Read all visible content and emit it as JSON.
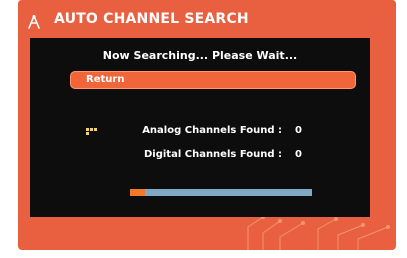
{
  "title": "AUTO CHANNEL SEARCH",
  "status": "Now Searching...  Please Wait...",
  "return_label": "Return",
  "analog_label": "Analog Channels Found :",
  "analog_value": "0",
  "digital_label": "Digital Channels Found :",
  "digital_value": "0",
  "progress": 0.08,
  "icons": {
    "title": "antenna-icon",
    "list": "dots-icon"
  },
  "colors": {
    "frame": "#e8603f",
    "panel": "#0d0d0d",
    "button": "#f0663a",
    "progress_track": "#7fa9c4",
    "progress_fill": "#f07a2a",
    "text": "#ffffff"
  }
}
